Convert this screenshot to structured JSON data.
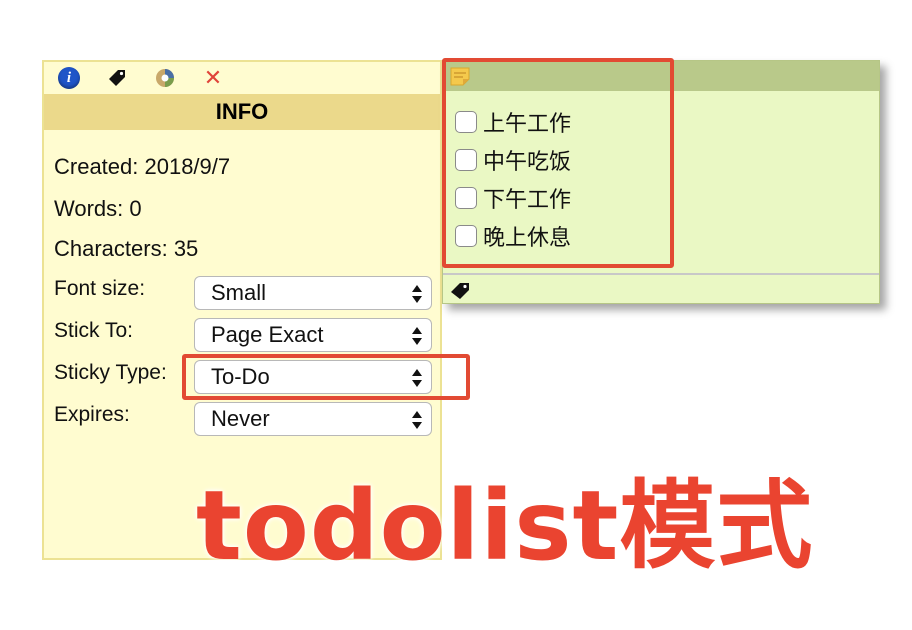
{
  "info_panel": {
    "header": "INFO",
    "toolbar_icons": [
      "info-icon",
      "tag-icon",
      "color-wheel-icon",
      "close-icon"
    ],
    "close_glyph": "✕",
    "info_glyph": "i",
    "stats": {
      "created": "Created: 2018/9/7",
      "words": "Words: 0",
      "characters": "Characters: 35"
    },
    "fields": {
      "font_size": {
        "label": "Font size:",
        "value": "Small"
      },
      "stick_to": {
        "label": "Stick To:",
        "value": "Page Exact"
      },
      "sticky_type": {
        "label": "Sticky Type:",
        "value": "To-Do"
      },
      "expires": {
        "label": "Expires:",
        "value": "Never"
      }
    }
  },
  "sticky_note": {
    "todos": [
      {
        "text": "上午工作",
        "checked": false
      },
      {
        "text": "中午吃饭",
        "checked": false
      },
      {
        "text": "下午工作",
        "checked": false
      },
      {
        "text": "晚上休息",
        "checked": false
      }
    ]
  },
  "annotation": {
    "caption": "todolist模式",
    "color": "#e24a33"
  },
  "colors": {
    "panel_bg": "#fffcd0",
    "panel_header": "#ebd98b",
    "sticky_bg": "#eaf8c4",
    "sticky_header": "#b9c98a"
  }
}
